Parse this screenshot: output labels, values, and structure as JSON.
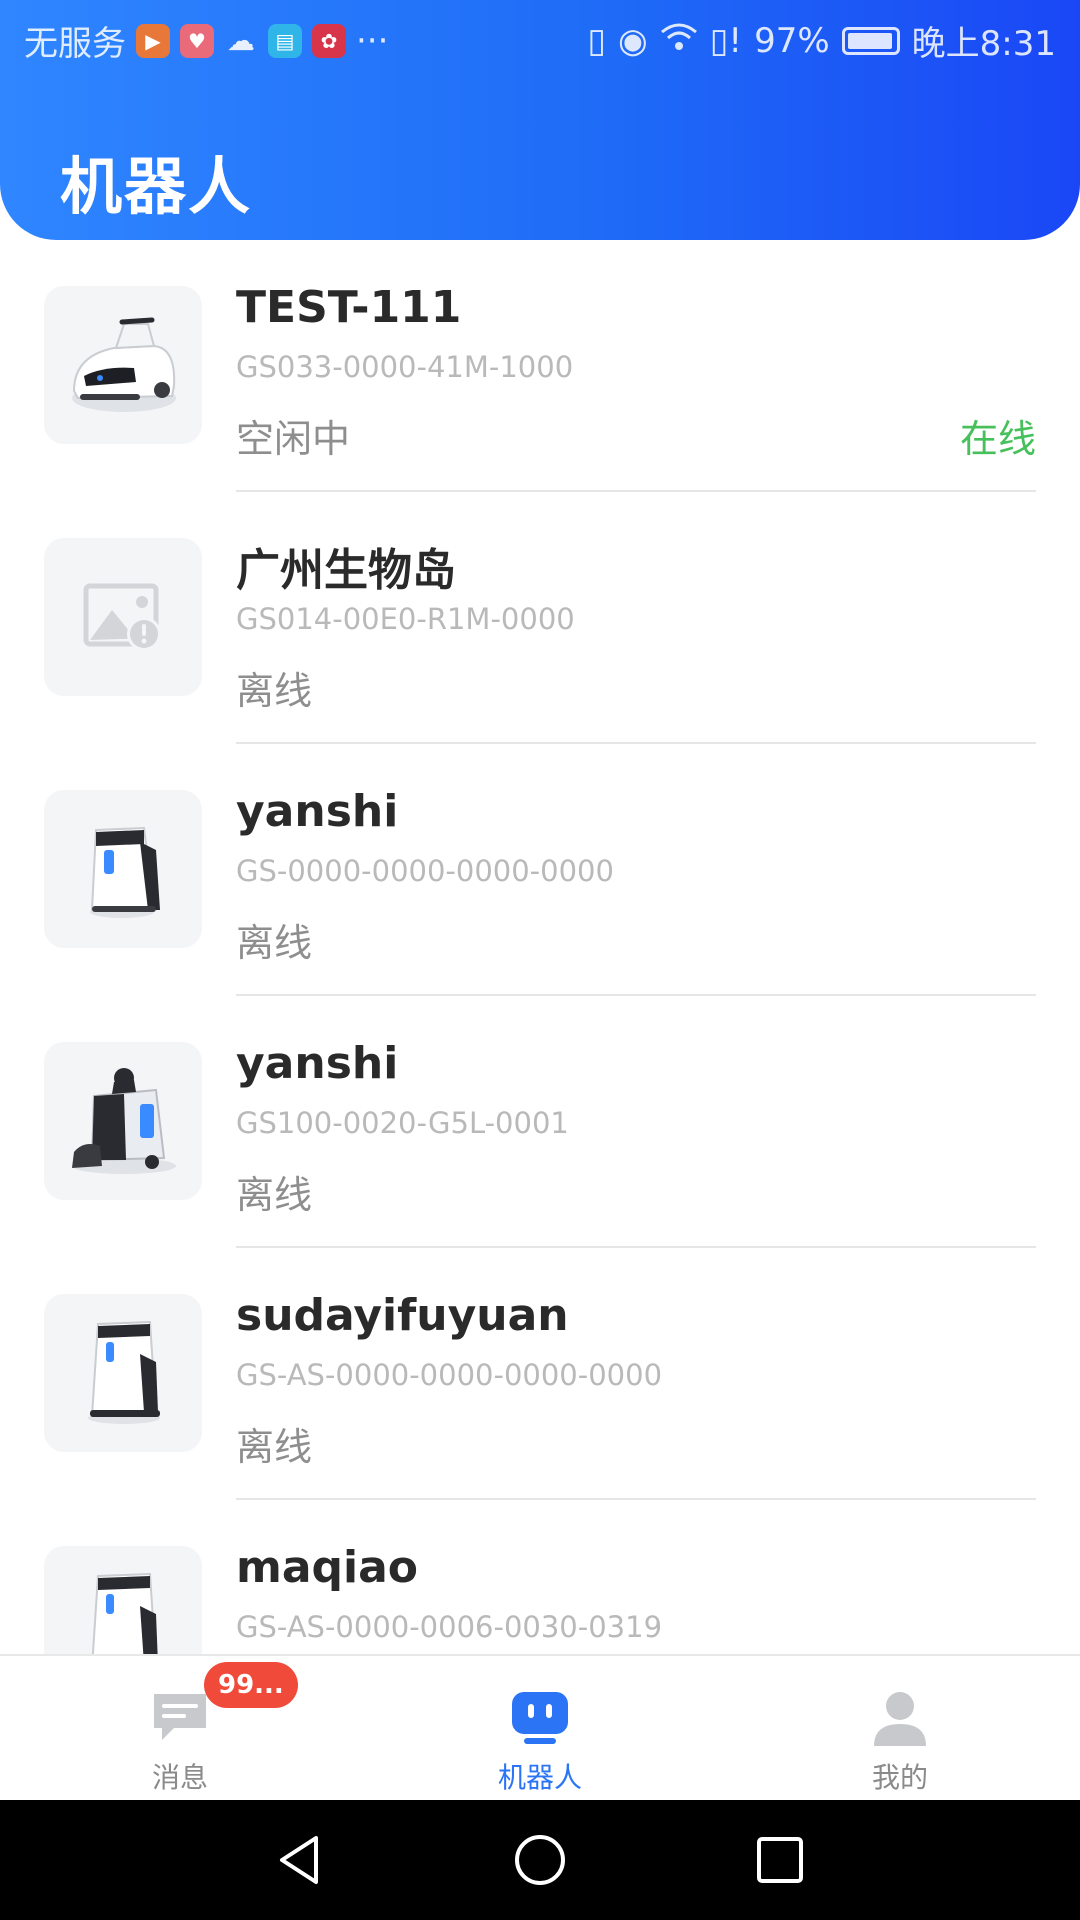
{
  "status_bar": {
    "carrier": "无服务",
    "battery_percent": "97%",
    "time": "晚上8:31",
    "more": "···",
    "icons": [
      "video-app-icon",
      "health-app-icon",
      "cloud-icon",
      "books-app-icon",
      "huawei-app-icon",
      "vibrate-icon",
      "eye-comfort-icon",
      "wifi-icon",
      "sim-alert-icon",
      "battery-icon"
    ]
  },
  "header": {
    "title": "机器人"
  },
  "robots": [
    {
      "name": "TEST-111",
      "serial": "GS033-0000-41M-1000",
      "state": "空闲中",
      "online_label": "在线",
      "image": "robot-sweeper-image"
    },
    {
      "name": "广州生物岛",
      "serial": "GS014-00E0-R1M-0000",
      "state": "离线",
      "image": "image-placeholder-icon"
    },
    {
      "name": "yanshi",
      "serial": "GS-0000-0000-0000-0000",
      "state": "离线",
      "image": "robot-scrubber-image"
    },
    {
      "name": "yanshi",
      "serial": "GS100-0020-G5L-0001",
      "state": "离线",
      "image": "robot-ride-on-image"
    },
    {
      "name": "sudayifuyuan",
      "serial": "GS-AS-0000-0000-0000-0000",
      "state": "离线",
      "image": "robot-scrubber-image"
    },
    {
      "name": "maqiao",
      "serial": "GS-AS-0000-0006-0030-0319",
      "state": "",
      "image": "robot-scrubber-image"
    }
  ],
  "tabbar": {
    "messages": {
      "label": "消息",
      "badge": "99..."
    },
    "robots": {
      "label": "机器人"
    },
    "mine": {
      "label": "我的"
    }
  },
  "colors": {
    "accent": "#2a74f5",
    "online": "#46c05b",
    "badge": "#f04a3a"
  }
}
